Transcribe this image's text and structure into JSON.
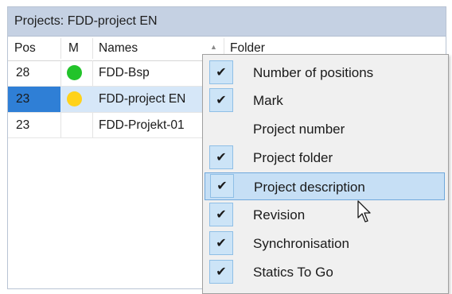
{
  "panel": {
    "title": "Projects: FDD-project EN"
  },
  "columns": {
    "pos": "Pos",
    "mark": "M",
    "names": "Names",
    "folder": "Folder"
  },
  "rows": [
    {
      "pos": "28",
      "mark_color": "#22c32a",
      "name": "FDD-Bsp",
      "selected": false
    },
    {
      "pos": "23",
      "mark_color": "#ffd21a",
      "name": "FDD-project EN",
      "selected": true
    },
    {
      "pos": "23",
      "mark_color": "",
      "name": "FDD-Projekt-01",
      "selected": false
    }
  ],
  "menu": {
    "items": [
      {
        "label": "Number of positions",
        "checked": true,
        "highlighted": false
      },
      {
        "label": "Mark",
        "checked": true,
        "highlighted": false
      },
      {
        "label": "Project number",
        "checked": false,
        "highlighted": false
      },
      {
        "label": "Project folder",
        "checked": true,
        "highlighted": false
      },
      {
        "label": "Project description",
        "checked": true,
        "highlighted": true
      },
      {
        "label": "Revision",
        "checked": true,
        "highlighted": false
      },
      {
        "label": "Synchronisation",
        "checked": true,
        "highlighted": false
      },
      {
        "label": "Statics To Go",
        "checked": true,
        "highlighted": false
      }
    ]
  },
  "colors": {
    "selection_pos": "#2f7fd6",
    "selection_row": "#d6e7f8",
    "menu_highlight": "#c6dff5",
    "check_bg": "#cce4f7"
  },
  "icons": {
    "sort": "sort-ascending-icon",
    "check": "checkmark-icon",
    "cursor": "arrow-cursor-icon"
  }
}
